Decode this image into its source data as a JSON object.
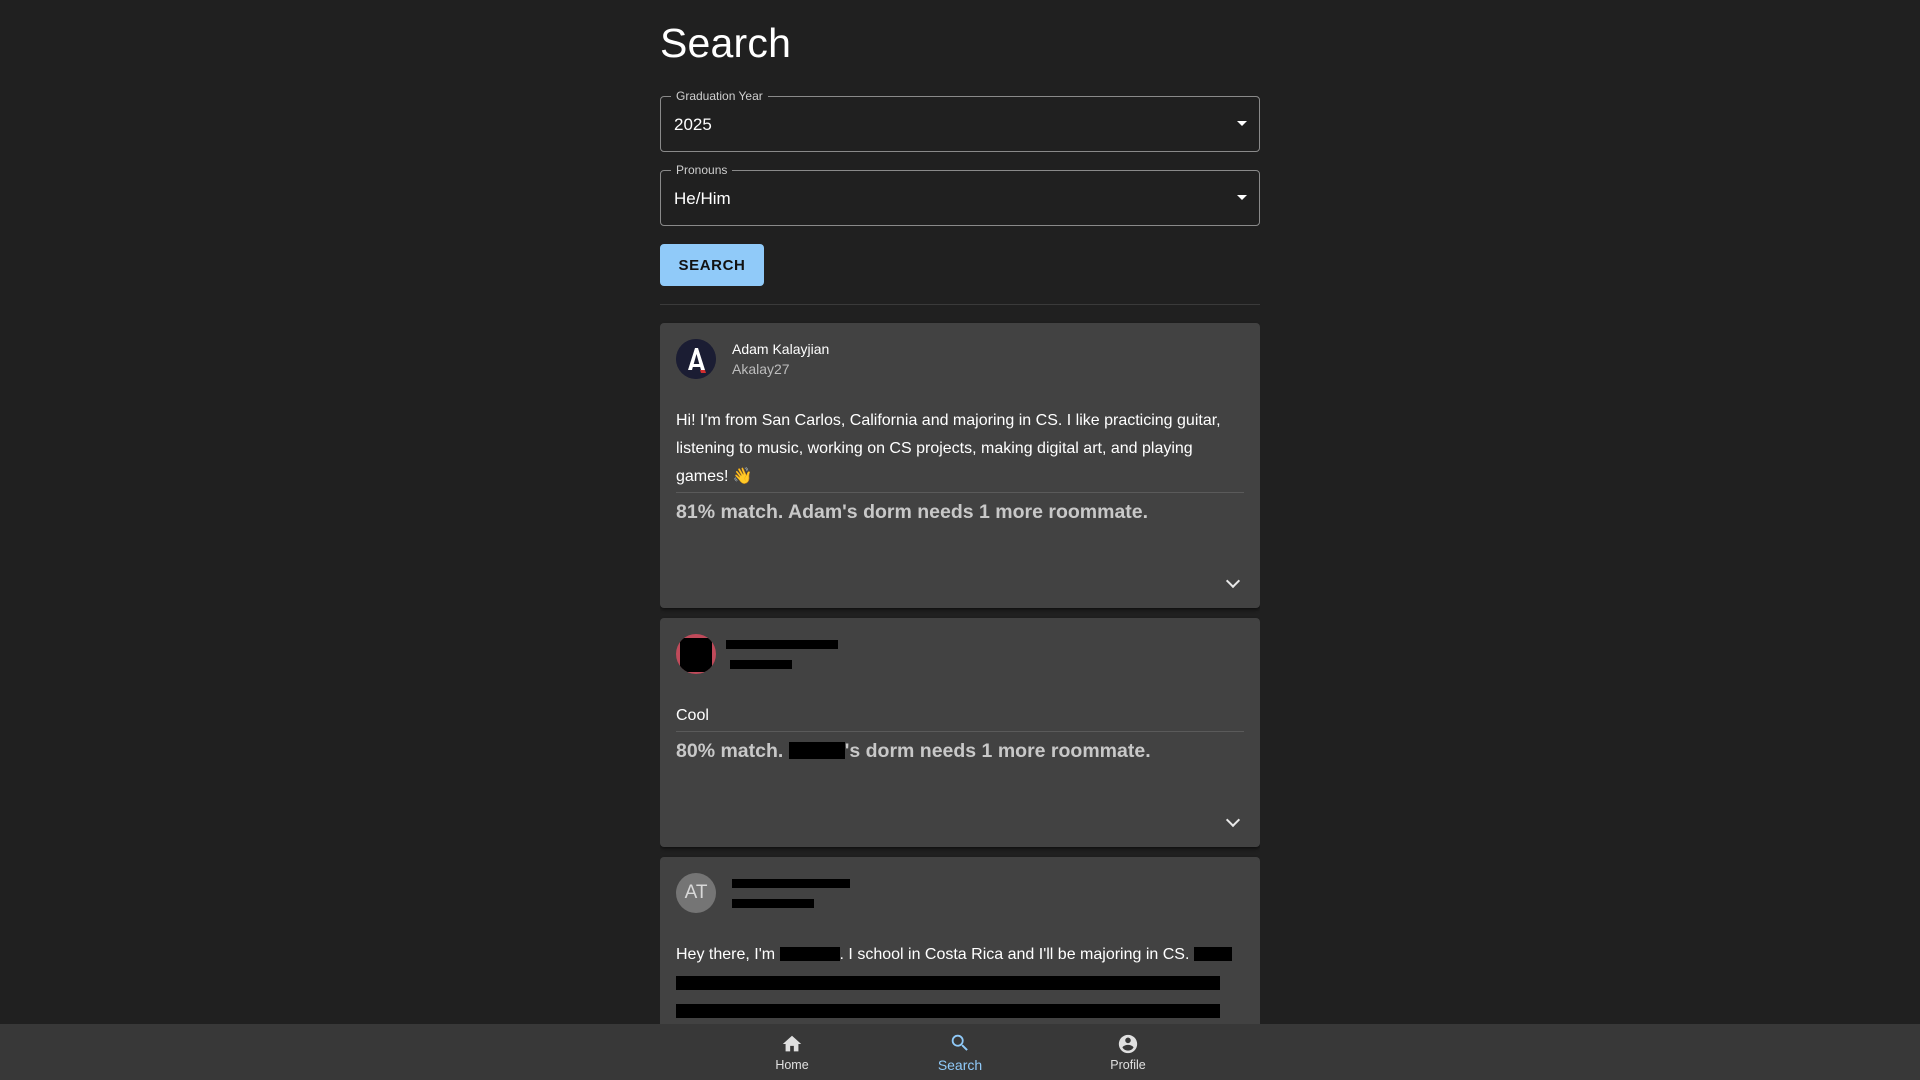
{
  "page": {
    "title": "Search"
  },
  "filters": {
    "graduation_year": {
      "label": "Graduation Year",
      "value": "2025"
    },
    "pronouns": {
      "label": "Pronouns",
      "value": "He/Him"
    },
    "search_label": "SEARCH"
  },
  "results": [
    {
      "name": "Adam Kalayjian",
      "handle": "Akalay27",
      "bio": "Hi! I'm from San Carlos, California and majoring in CS. I like practicing guitar, listening to music, working on CS projects, making digital art, and playing games! 👋",
      "match": "81% match. Adam's dorm needs 1 more roommate."
    },
    {
      "bio": "Cool",
      "match_prefix": "80% match. ",
      "match_suffix": "'s dorm needs 1 more roommate."
    },
    {
      "avatar_initials": "AT",
      "bio_start": "Hey there, I'm ",
      "bio_mid": ". I school in Costa Rica and I'll be majoring in CS."
    }
  ],
  "nav": {
    "items": [
      {
        "label": "Home",
        "icon": "home-icon"
      },
      {
        "label": "Search",
        "icon": "search-icon"
      },
      {
        "label": "Profile",
        "icon": "account-circle-icon"
      }
    ],
    "active": "Search"
  },
  "colors": {
    "background": "#202020",
    "card": "#424242",
    "accent": "#90caf9",
    "nav": "#383838"
  }
}
